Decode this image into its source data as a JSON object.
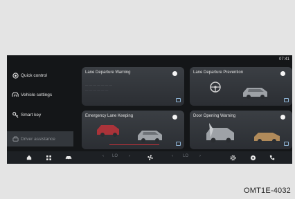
{
  "status": {
    "time": "07:41"
  },
  "sidebar": {
    "items": [
      {
        "label": "Quick control",
        "icon": "target-icon",
        "active": false
      },
      {
        "label": "Vehicle settings",
        "icon": "car-door-icon",
        "active": false
      },
      {
        "label": "Smart key",
        "icon": "key-icon",
        "active": false
      },
      {
        "label": "Driver assistance",
        "icon": "steering-assist-icon",
        "active": true
      }
    ]
  },
  "cards": [
    {
      "title": "Lane Departure Warning",
      "enabled": true
    },
    {
      "title": "Lane Departure Prevention",
      "enabled": true
    },
    {
      "title": "Emergency Lane Keeping",
      "enabled": true
    },
    {
      "title": "Door Opening Warning",
      "enabled": true
    }
  ],
  "bottombar": {
    "temp_left": "LO",
    "temp_right": "LO",
    "icons": [
      "home-icon",
      "apps-icon",
      "car-icon",
      "fan-icon",
      "settings-icon",
      "disc-icon",
      "phone-icon"
    ]
  },
  "caption": "OMT1E-4032",
  "colors": {
    "screen_bg": "#141618",
    "card_bg": "#34383d",
    "accent_blue": "#8fb6d8",
    "alert_red": "#c0323a"
  }
}
